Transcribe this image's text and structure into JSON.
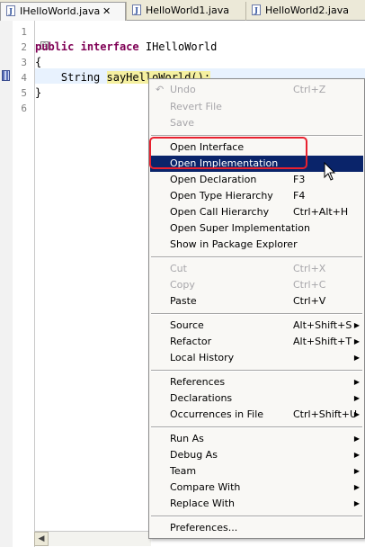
{
  "tabs": [
    {
      "label": "IHelloWorld.java",
      "active": true,
      "close": "✕"
    },
    {
      "label": "HelloWorld1.java",
      "active": false
    },
    {
      "label": "HelloWorld2.java",
      "active": false
    }
  ],
  "file_icon_letter": "J",
  "editor": {
    "line_numbers": [
      "1",
      "2",
      "3",
      "4",
      "5",
      "6"
    ],
    "lines": {
      "l2_kw1": "public",
      "l2_kw2": "interface",
      "l2_name": "IHelloWorld",
      "l3": "{",
      "l4_type": "String",
      "l4_method": "sayHelloWorld();",
      "l5": "}"
    },
    "fold_marker": "⊖"
  },
  "context_menu": {
    "items": [
      {
        "label": "Undo",
        "shortcut": "Ctrl+Z",
        "disabled": true
      },
      {
        "label": "Revert File",
        "disabled": true
      },
      {
        "label": "Save",
        "disabled": true
      },
      {
        "label": "Open Interface"
      },
      {
        "label": "Open Implementation",
        "selected": true
      },
      {
        "label": "Open Declaration",
        "shortcut": "F3"
      },
      {
        "label": "Open Type Hierarchy",
        "shortcut": "F4"
      },
      {
        "label": "Open Call Hierarchy",
        "shortcut": "Ctrl+Alt+H"
      },
      {
        "label": "Open Super Implementation"
      },
      {
        "label": "Show in Package Explorer"
      },
      {
        "label": "Cut",
        "shortcut": "Ctrl+X",
        "disabled": true
      },
      {
        "label": "Copy",
        "shortcut": "Ctrl+C",
        "disabled": true
      },
      {
        "label": "Paste",
        "shortcut": "Ctrl+V"
      },
      {
        "label": "Source",
        "shortcut": "Alt+Shift+S",
        "submenu": true
      },
      {
        "label": "Refactor",
        "shortcut": "Alt+Shift+T",
        "submenu": true
      },
      {
        "label": "Local History",
        "submenu": true
      },
      {
        "label": "References",
        "submenu": true
      },
      {
        "label": "Declarations",
        "submenu": true
      },
      {
        "label": "Occurrences in File",
        "shortcut": "Ctrl+Shift+U",
        "submenu": true
      },
      {
        "label": "Run As",
        "submenu": true
      },
      {
        "label": "Debug As",
        "submenu": true
      },
      {
        "label": "Team",
        "submenu": true
      },
      {
        "label": "Compare With",
        "submenu": true
      },
      {
        "label": "Replace With",
        "submenu": true
      },
      {
        "label": "Preferences..."
      }
    ],
    "submenu_arrow": "▶",
    "undo_icon": "↶"
  },
  "hscroll_arrow": "◀",
  "colors": {
    "keyword": "#7f0055",
    "selection": "#0a246a",
    "annotation": "#e8212f",
    "highlight": "#f5f0a0"
  }
}
